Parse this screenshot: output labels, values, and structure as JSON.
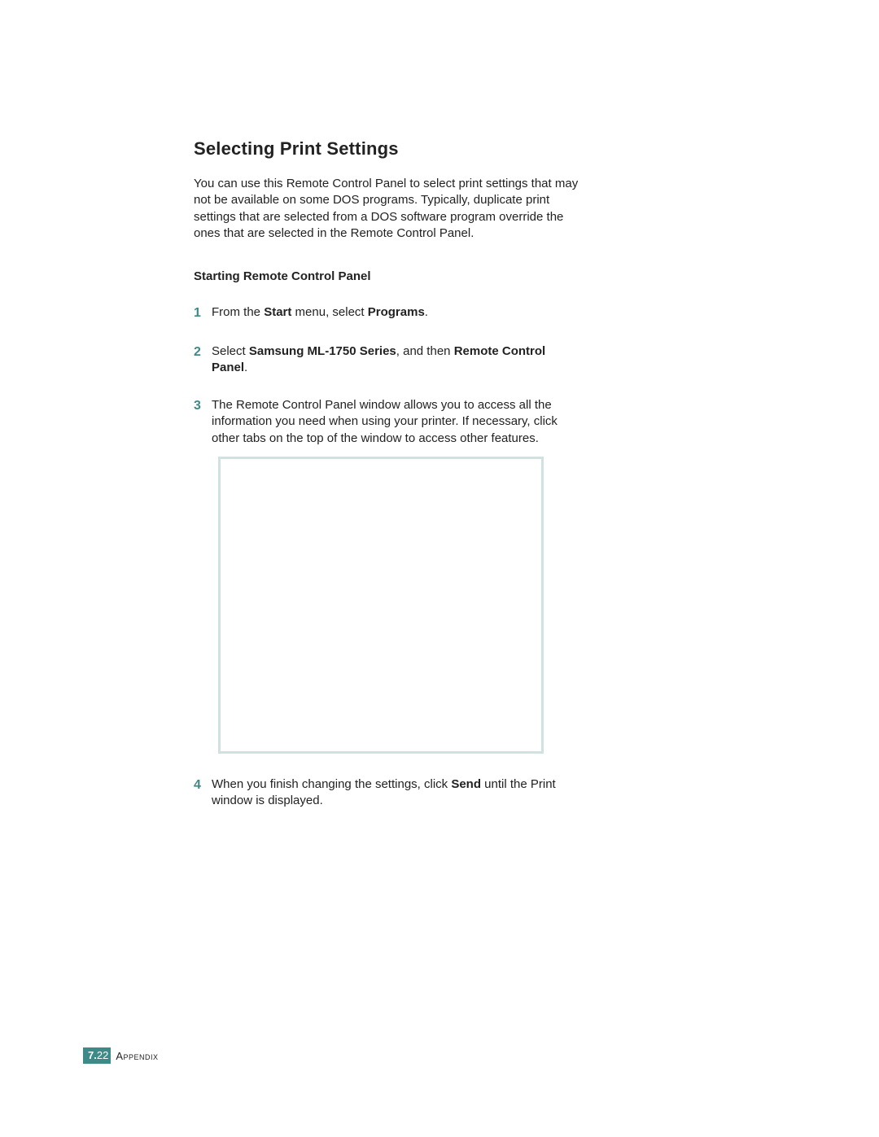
{
  "title": "Selecting Print Settings",
  "intro": "You can use this Remote Control Panel to select print settings that may not be available on some DOS programs. Typically, duplicate print settings that are selected from a DOS software program override the ones that are selected in the Remote Control Panel.",
  "subheading": "Starting Remote Control Panel",
  "steps": {
    "1": {
      "num": "1",
      "pre": "From the ",
      "b1": "Start",
      "mid": " menu, select ",
      "b2": "Programs",
      "post": "."
    },
    "2": {
      "num": "2",
      "pre": "Select ",
      "b1": "Samsung ML-1750 Series",
      "mid": ", and then ",
      "b2": "Remote Control Panel",
      "post": "."
    },
    "3": {
      "num": "3",
      "text": "The Remote Control Panel window allows you to access all the information you need when using your printer. If necessary, click other tabs on the top of the window to access other features."
    },
    "4": {
      "num": "4",
      "pre": "When you finish changing the settings, click ",
      "b1": "Send",
      "post": " until the Print window is displayed."
    }
  },
  "footer": {
    "chapter": "7.",
    "page": "22",
    "label": "Appendix"
  }
}
